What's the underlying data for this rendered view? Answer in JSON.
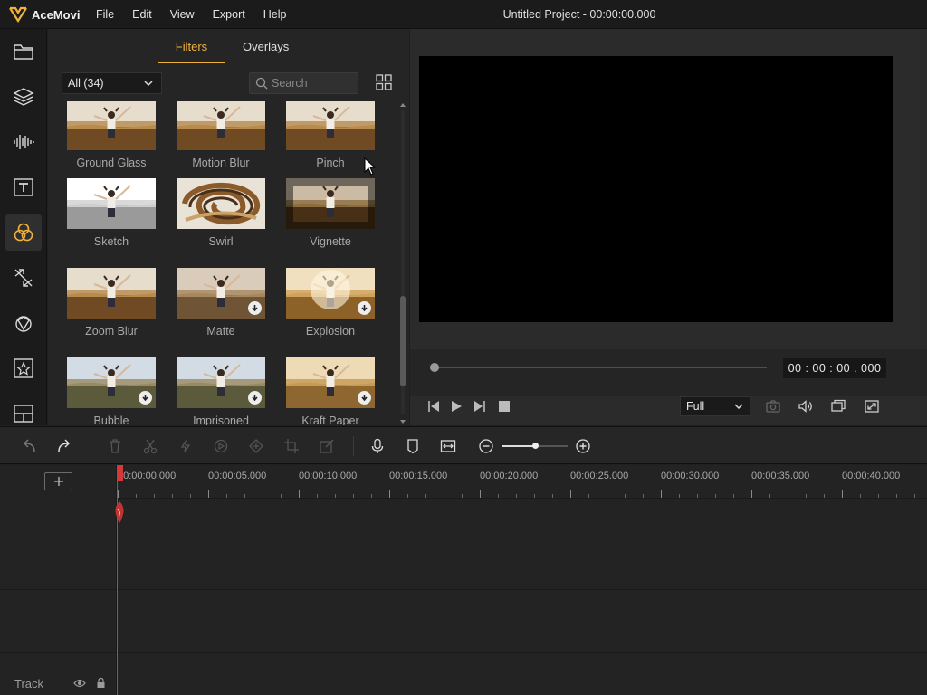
{
  "app": {
    "brand": "AceMovi",
    "menus": [
      "File",
      "Edit",
      "View",
      "Export",
      "Help"
    ],
    "project_title": "Untitled Project - 00:00:00.000",
    "accent_color": "#f0b23c"
  },
  "rail": {
    "items": [
      {
        "icon": "folder-icon",
        "active": false
      },
      {
        "icon": "layers-icon",
        "active": false
      },
      {
        "icon": "audio-waveform-icon",
        "active": false
      },
      {
        "icon": "text-icon",
        "active": false
      },
      {
        "icon": "filters-icon",
        "active": true
      },
      {
        "icon": "transition-icon",
        "active": false
      },
      {
        "icon": "element-icon",
        "active": false
      },
      {
        "icon": "sticker-star-icon",
        "active": false
      },
      {
        "icon": "layout-icon",
        "active": false
      }
    ]
  },
  "panel": {
    "tabs": [
      "Filters",
      "Overlays"
    ],
    "active_tab": "Filters",
    "category": "All (34)",
    "search_placeholder": "Search",
    "filters": [
      {
        "name": "Ground Glass",
        "download": false,
        "style": "warm"
      },
      {
        "name": "Motion Blur",
        "download": false,
        "style": "warm"
      },
      {
        "name": "Pinch",
        "download": false,
        "style": "warm"
      },
      {
        "name": "Sketch",
        "download": false,
        "style": "sketch"
      },
      {
        "name": "Swirl",
        "download": false,
        "style": "swirl"
      },
      {
        "name": "Vignette",
        "download": false,
        "style": "vignette"
      },
      {
        "name": "Zoom Blur",
        "download": false,
        "style": "warm"
      },
      {
        "name": "Matte",
        "download": true,
        "style": "matte"
      },
      {
        "name": "Explosion",
        "download": true,
        "style": "explosion"
      },
      {
        "name": "Bubble",
        "download": true,
        "style": "cool"
      },
      {
        "name": "Imprisoned",
        "download": true,
        "style": "cool"
      },
      {
        "name": "Kraft Paper",
        "download": true,
        "style": "kraft"
      }
    ]
  },
  "preview": {
    "timecode": "00 : 00 : 00 . 000",
    "zoom": "Full",
    "progress": 0
  },
  "timeline": {
    "ruler_labels": [
      "00:00:00.000",
      "00:00:05.000",
      "00:00:10.000",
      "00:00:15.000",
      "00:00:20.000",
      "00:00:25.000",
      "00:00:30.000",
      "00:00:35.000",
      "00:00:40.000"
    ],
    "track_label": "Track",
    "zoom_level": 0.5
  }
}
